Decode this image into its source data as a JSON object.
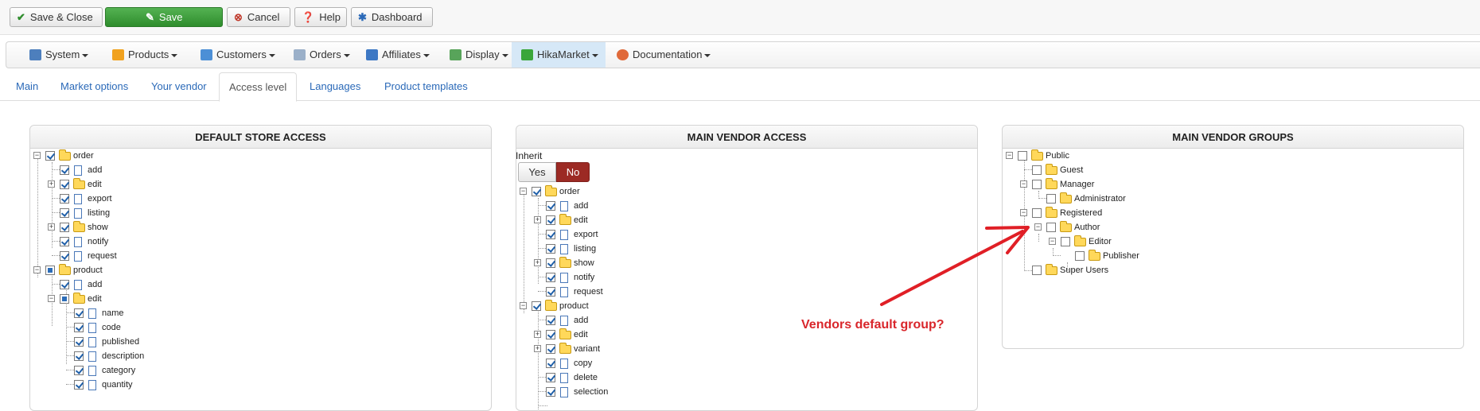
{
  "toolbar": {
    "save_close": "Save & Close",
    "save": "Save",
    "cancel": "Cancel",
    "help": "Help",
    "dashboard": "Dashboard"
  },
  "menu": {
    "items": [
      "System",
      "Products",
      "Customers",
      "Orders",
      "Affiliates",
      "Display",
      "HikaMarket",
      "Documentation"
    ],
    "active_item": "HikaMarket"
  },
  "tabs": {
    "items": [
      "Main",
      "Market options",
      "Your vendor",
      "Access level",
      "Languages",
      "Product templates"
    ],
    "active_tab": "Access level"
  },
  "panels": {
    "default_store": {
      "title": "DEFAULT STORE ACCESS",
      "nodes": [
        "order",
        "add",
        "edit",
        "export",
        "listing",
        "show",
        "notify",
        "request",
        "product",
        "add",
        "edit",
        "name",
        "code",
        "published",
        "description",
        "category",
        "quantity"
      ]
    },
    "main_vendor": {
      "title": "MAIN VENDOR ACCESS",
      "inherit_label": "Inherit",
      "yes": "Yes",
      "no": "No",
      "nodes": [
        "order",
        "add",
        "edit",
        "export",
        "listing",
        "show",
        "notify",
        "request",
        "product",
        "add",
        "edit",
        "variant",
        "copy",
        "delete",
        "selection"
      ]
    },
    "vendor_groups": {
      "title": "MAIN VENDOR GROUPS",
      "nodes": [
        "Public",
        "Guest",
        "Manager",
        "Administrator",
        "Registered",
        "Author",
        "Editor",
        "Publisher",
        "Super Users"
      ]
    }
  },
  "annotation": {
    "text": "Vendors default group?",
    "color": "#d9262b"
  },
  "colors": {
    "save_green": "#3a9b38",
    "no_red": "#9c2a24",
    "link_blue": "#2a69b8",
    "active_menu": "#d6e8f7"
  }
}
